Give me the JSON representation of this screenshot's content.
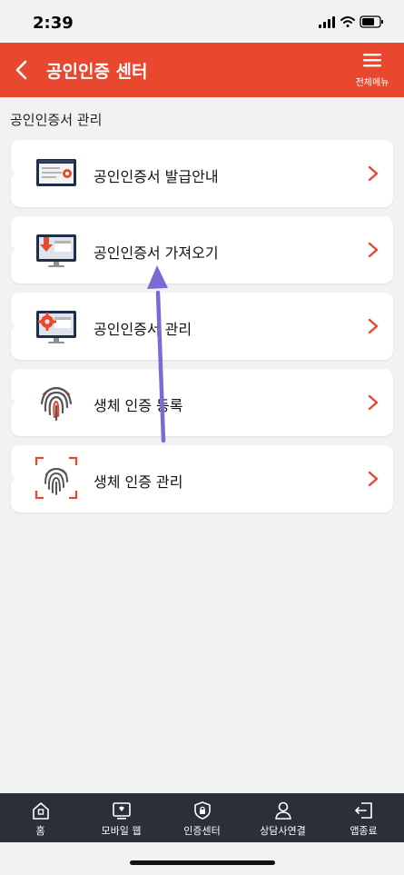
{
  "status_bar": {
    "time": "2:39"
  },
  "header": {
    "title": "공인인증 센터",
    "menu_label": "전체메뉴"
  },
  "section": {
    "title": "공인인증서 관리"
  },
  "items": [
    {
      "label": "공인인증서 발급안내",
      "icon": "certificate-monitor-icon"
    },
    {
      "label": "공인인증서 가져오기",
      "icon": "download-monitor-icon"
    },
    {
      "label": "공인인증서 관리",
      "icon": "gear-monitor-icon"
    },
    {
      "label": "생체 인증 등록",
      "icon": "fingerprint-icon"
    },
    {
      "label": "생체 인증 관리",
      "icon": "fingerprint-scan-icon"
    }
  ],
  "bottom_nav": [
    {
      "label": "홈",
      "icon": "home-icon"
    },
    {
      "label": "모바일 웹",
      "icon": "mobile-web-icon"
    },
    {
      "label": "인증센터",
      "icon": "lock-shield-icon"
    },
    {
      "label": "상담사연결",
      "icon": "person-icon"
    },
    {
      "label": "앱종료",
      "icon": "exit-icon"
    }
  ],
  "colors": {
    "brand": "#e8482d",
    "nav_bg": "#2a2f3a",
    "annotation_arrow": "#7b6ad6"
  }
}
